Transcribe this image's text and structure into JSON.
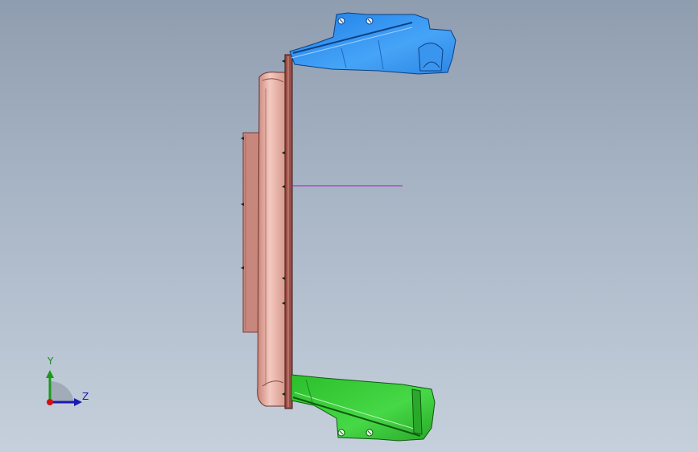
{
  "viewport": {
    "title": "",
    "triad": {
      "y_label": "Y",
      "z_label": "Z"
    }
  },
  "colors": {
    "background_top": "#8f9db0",
    "background_bottom": "#c6d0dc",
    "upper_bracket": "#2f8cf0",
    "lower_bracket": "#33c233",
    "panel": "#e3a79d",
    "back_plate": "#c8877c",
    "frame_edge": "#5a2a26",
    "center_line": "#a020c0"
  },
  "icons": [
    "axis-triad-icon"
  ]
}
